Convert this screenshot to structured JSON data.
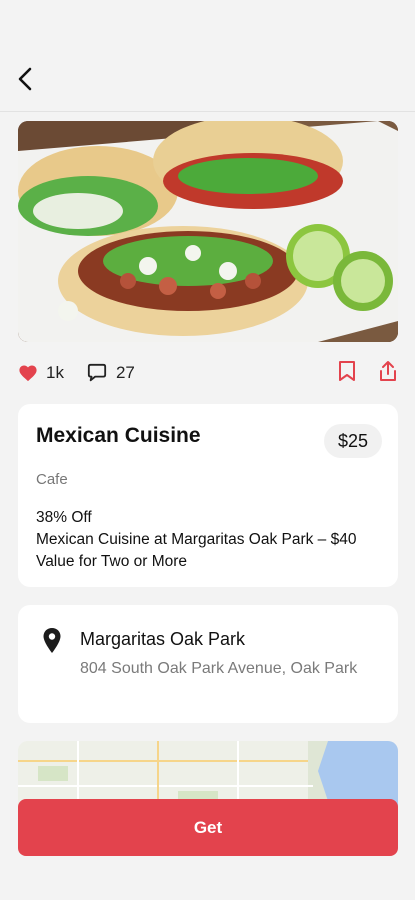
{
  "header": {
    "back_icon": "chevron-left-icon"
  },
  "hero": {
    "image_alt": "tacos-photo"
  },
  "social": {
    "likes": "1k",
    "comments": "27",
    "like_icon": "heart-icon",
    "comment_icon": "comment-bubble-icon",
    "bookmark_icon": "bookmark-icon",
    "share_icon": "share-icon",
    "accent_color": "#e3434d"
  },
  "deal": {
    "title": "Mexican Cuisine",
    "price": "$25",
    "category": "Cafe",
    "discount": "38% Off",
    "description": "Mexican Cuisine at Margaritas Oak Park – $40 Value for Two or More"
  },
  "location": {
    "name": "Margaritas Oak Park",
    "address": "804 South Oak Park Avenue, Oak Park",
    "pin_icon": "location-pin-icon"
  },
  "cta": {
    "label": "Get",
    "color": "#e3434d"
  }
}
